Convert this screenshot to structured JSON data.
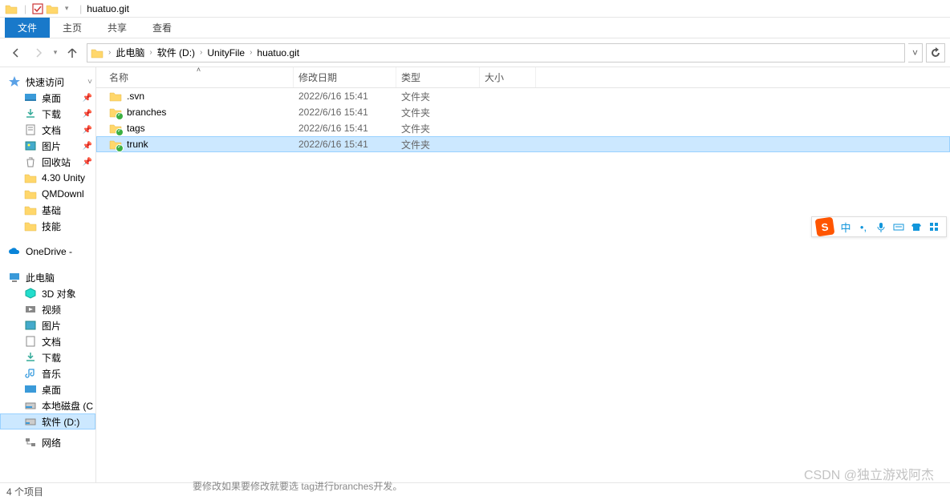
{
  "window": {
    "title": "huatuo.git"
  },
  "ribbon": {
    "tabs": [
      "文件",
      "主页",
      "共享",
      "查看"
    ],
    "active_index": 0
  },
  "breadcrumb": {
    "items": [
      "此电脑",
      "软件 (D:)",
      "UnityFile",
      "huatuo.git"
    ]
  },
  "columns": {
    "name": "名称",
    "date": "修改日期",
    "type": "类型",
    "size": "大小"
  },
  "rows": [
    {
      "name": ".svn",
      "date": "2022/6/16 15:41",
      "type": "文件夹",
      "svn": false
    },
    {
      "name": "branches",
      "date": "2022/6/16 15:41",
      "type": "文件夹",
      "svn": true
    },
    {
      "name": "tags",
      "date": "2022/6/16 15:41",
      "type": "文件夹",
      "svn": true
    },
    {
      "name": "trunk",
      "date": "2022/6/16 15:41",
      "type": "文件夹",
      "svn": true,
      "selected": true
    }
  ],
  "sidebar": {
    "quick_access": "快速访问",
    "quick_items": [
      "桌面",
      "下载",
      "文档",
      "图片",
      "回收站",
      "4.30 Unity",
      "QMDownl",
      "基础",
      "技能"
    ],
    "onedrive": "OneDrive -",
    "this_pc": "此电脑",
    "pc_items": [
      "3D 对象",
      "视频",
      "图片",
      "文档",
      "下载",
      "音乐",
      "桌面",
      "本地磁盘 (C",
      "软件 (D:)"
    ],
    "network": "网络",
    "selected_pc_index": 8
  },
  "status": {
    "text": "4 个项目"
  },
  "ime": {
    "lang": "中"
  },
  "watermark": "CSDN @独立游戏阿杰",
  "cut_text": "要修改如果要修改就要选    tag进行branches开发。"
}
